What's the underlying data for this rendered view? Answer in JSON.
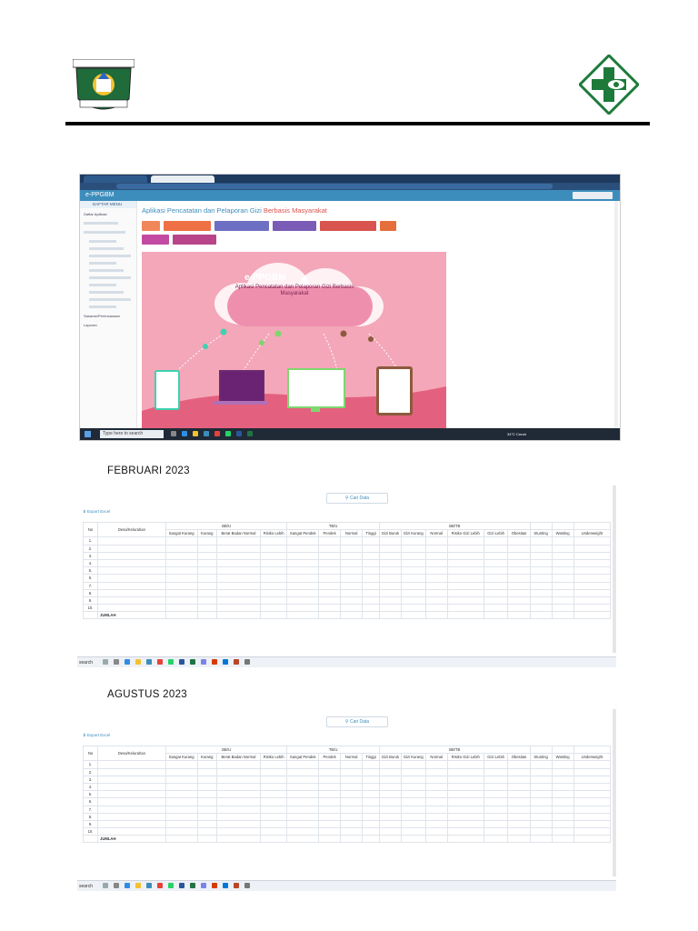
{
  "header": {
    "left_logo_icon": "kabupaten-pasuruan-emblem",
    "right_logo_icon": "puskesmas-logo"
  },
  "screenshot1": {
    "browser_tabs": [
      "WhatsApp",
      ""
    ],
    "address": "",
    "app_brand": "e-PPGBM",
    "sidebar_title": "DAFTAR MENU",
    "sidebar_items": [
      "Daftar Aplikasi",
      "",
      "",
      "",
      "",
      "",
      "",
      "",
      "",
      "",
      "",
      "",
      "",
      "Sasaran/Perencanaan",
      "Laporan"
    ],
    "page_title": "Aplikasi Pencatatan dan Pelaporan Gizi",
    "page_title_accent": "Berbasis Masyarakat",
    "buttons": [
      {
        "label": "",
        "color": "#f0875a"
      },
      {
        "label": "",
        "color": "#ee7044"
      },
      {
        "label": "",
        "color": "#6d6fc2"
      },
      {
        "label": "",
        "color": "#7a5bb5"
      },
      {
        "label": "",
        "color": "#d9534f"
      },
      {
        "label": "",
        "color": "#e66e3b"
      },
      {
        "label": "",
        "color": "#c34aa2"
      },
      {
        "label": "",
        "color": "#b8448a"
      }
    ],
    "banner_title": "e-PPGBM",
    "banner_subtitle": "Aplikasi Pencatatan dan Pelaporan Gizi Berbasis Masyarakat",
    "taskbar_search": "Type here to search",
    "taskbar_weather": "34°C Cerah",
    "taskbar_clock": [
      "",
      ""
    ]
  },
  "months": [
    "FEBRUARI 2023",
    "AGUSTUS 2023"
  ],
  "tables": [
    {
      "cari": "Cari Data",
      "export": "Export Excel",
      "date": "",
      "groups": [
        "BB/U",
        "TB/U",
        "BB/TB"
      ],
      "columns": [
        "No",
        "Desa/Kelurahan",
        "Sangat Kurang",
        "Kurang",
        "Berat Badan Normal",
        "Risiko Lebih",
        "Sangat Pendek",
        "Pendek",
        "Normal",
        "Tinggi",
        "Gizi Buruk",
        "Gizi Kurang",
        "Normal",
        "Risiko Gizi Lebih",
        "Gizi Lebih",
        "Obesitas",
        "Stunting",
        "Wasting",
        "Underweight"
      ],
      "rows": [
        [
          "1.",
          "",
          "",
          "",
          "",
          "",
          "",
          "",
          "",
          "",
          "",
          "",
          "",
          "",
          "",
          "",
          "",
          "",
          ""
        ],
        [
          "2.",
          "",
          "",
          "",
          "",
          "",
          "",
          "",
          "",
          "",
          "",
          "",
          "",
          "",
          "",
          "",
          "",
          "",
          ""
        ],
        [
          "3.",
          "",
          "",
          "",
          "",
          "",
          "",
          "",
          "",
          "",
          "",
          "",
          "",
          "",
          "",
          "",
          "",
          "",
          ""
        ],
        [
          "4.",
          "",
          "",
          "",
          "",
          "",
          "",
          "",
          "",
          "",
          "",
          "",
          "",
          "",
          "",
          "",
          "",
          "",
          ""
        ],
        [
          "5.",
          "",
          "",
          "",
          "",
          "",
          "",
          "",
          "",
          "",
          "",
          "",
          "",
          "",
          "",
          "",
          "",
          "",
          ""
        ],
        [
          "6.",
          "",
          "",
          "",
          "",
          "",
          "",
          "",
          "",
          "",
          "",
          "",
          "",
          "",
          "",
          "",
          "",
          "",
          ""
        ],
        [
          "7.",
          "",
          "",
          "",
          "",
          "",
          "",
          "",
          "",
          "",
          "",
          "",
          "",
          "",
          "",
          "",
          "",
          "",
          ""
        ],
        [
          "8.",
          "",
          "",
          "",
          "",
          "",
          "",
          "",
          "",
          "",
          "",
          "",
          "",
          "",
          "",
          "",
          "",
          "",
          ""
        ],
        [
          "9.",
          "",
          "",
          "",
          "",
          "",
          "",
          "",
          "",
          "",
          "",
          "",
          "",
          "",
          "",
          "",
          "",
          "",
          ""
        ],
        [
          "10.",
          "",
          "",
          "",
          "",
          "",
          "",
          "",
          "",
          "",
          "",
          "",
          "",
          "",
          "",
          "",
          "",
          "",
          ""
        ]
      ],
      "total_label": "JUMLAH",
      "totals": [
        "",
        "",
        "",
        "",
        "",
        "",
        "",
        "",
        "",
        "",
        "",
        "",
        "",
        "",
        "",
        "",
        ""
      ],
      "footer": "",
      "task_search": "search",
      "task_temp": "",
      "task_clock": [
        "",
        ""
      ]
    },
    {
      "cari": "Cari Data",
      "export": "Export Excel",
      "date": "",
      "groups": [
        "BB/U",
        "TB/U",
        "BB/TB"
      ],
      "columns": [
        "No",
        "Desa/Kelurahan",
        "Sangat Kurang",
        "Kurang",
        "Berat Badan Normal",
        "Risiko Lebih",
        "Sangat Pendek",
        "Pendek",
        "Normal",
        "Tinggi",
        "Gizi Buruk",
        "Gizi Kurang",
        "Normal",
        "Risiko Gizi Lebih",
        "Gizi Lebih",
        "Obesitas",
        "Stunting",
        "Wasting",
        "Underweight"
      ],
      "rows": [
        [
          "1.",
          "",
          "",
          "",
          "",
          "",
          "",
          "",
          "",
          "",
          "",
          "",
          "",
          "",
          "",
          "",
          "",
          "",
          ""
        ],
        [
          "2.",
          "",
          "",
          "",
          "",
          "",
          "",
          "",
          "",
          "",
          "",
          "",
          "",
          "",
          "",
          "",
          "",
          "",
          ""
        ],
        [
          "3.",
          "",
          "",
          "",
          "",
          "",
          "",
          "",
          "",
          "",
          "",
          "",
          "",
          "",
          "",
          "",
          "",
          "",
          ""
        ],
        [
          "4.",
          "",
          "",
          "",
          "",
          "",
          "",
          "",
          "",
          "",
          "",
          "",
          "",
          "",
          "",
          "",
          "",
          "",
          ""
        ],
        [
          "5.",
          "",
          "",
          "",
          "",
          "",
          "",
          "",
          "",
          "",
          "",
          "",
          "",
          "",
          "",
          "",
          "",
          "",
          ""
        ],
        [
          "6.",
          "",
          "",
          "",
          "",
          "",
          "",
          "",
          "",
          "",
          "",
          "",
          "",
          "",
          "",
          "",
          "",
          "",
          ""
        ],
        [
          "7.",
          "",
          "",
          "",
          "",
          "",
          "",
          "",
          "",
          "",
          "",
          "",
          "",
          "",
          "",
          "",
          "",
          "",
          ""
        ],
        [
          "8.",
          "",
          "",
          "",
          "",
          "",
          "",
          "",
          "",
          "",
          "",
          "",
          "",
          "",
          "",
          "",
          "",
          "",
          ""
        ],
        [
          "9.",
          "",
          "",
          "",
          "",
          "",
          "",
          "",
          "",
          "",
          "",
          "",
          "",
          "",
          "",
          "",
          "",
          "",
          ""
        ],
        [
          "10.",
          "",
          "",
          "",
          "",
          "",
          "",
          "",
          "",
          "",
          "",
          "",
          "",
          "",
          "",
          "",
          "",
          "",
          ""
        ]
      ],
      "total_label": "JUMLAH",
      "totals": [
        "",
        "",
        "",
        "",
        "",
        "",
        "",
        "",
        "",
        "",
        "",
        "",
        "",
        "",
        "",
        "",
        ""
      ],
      "footer": "",
      "task_search": "search",
      "task_temp": "",
      "task_clock": [
        "",
        ""
      ]
    }
  ]
}
